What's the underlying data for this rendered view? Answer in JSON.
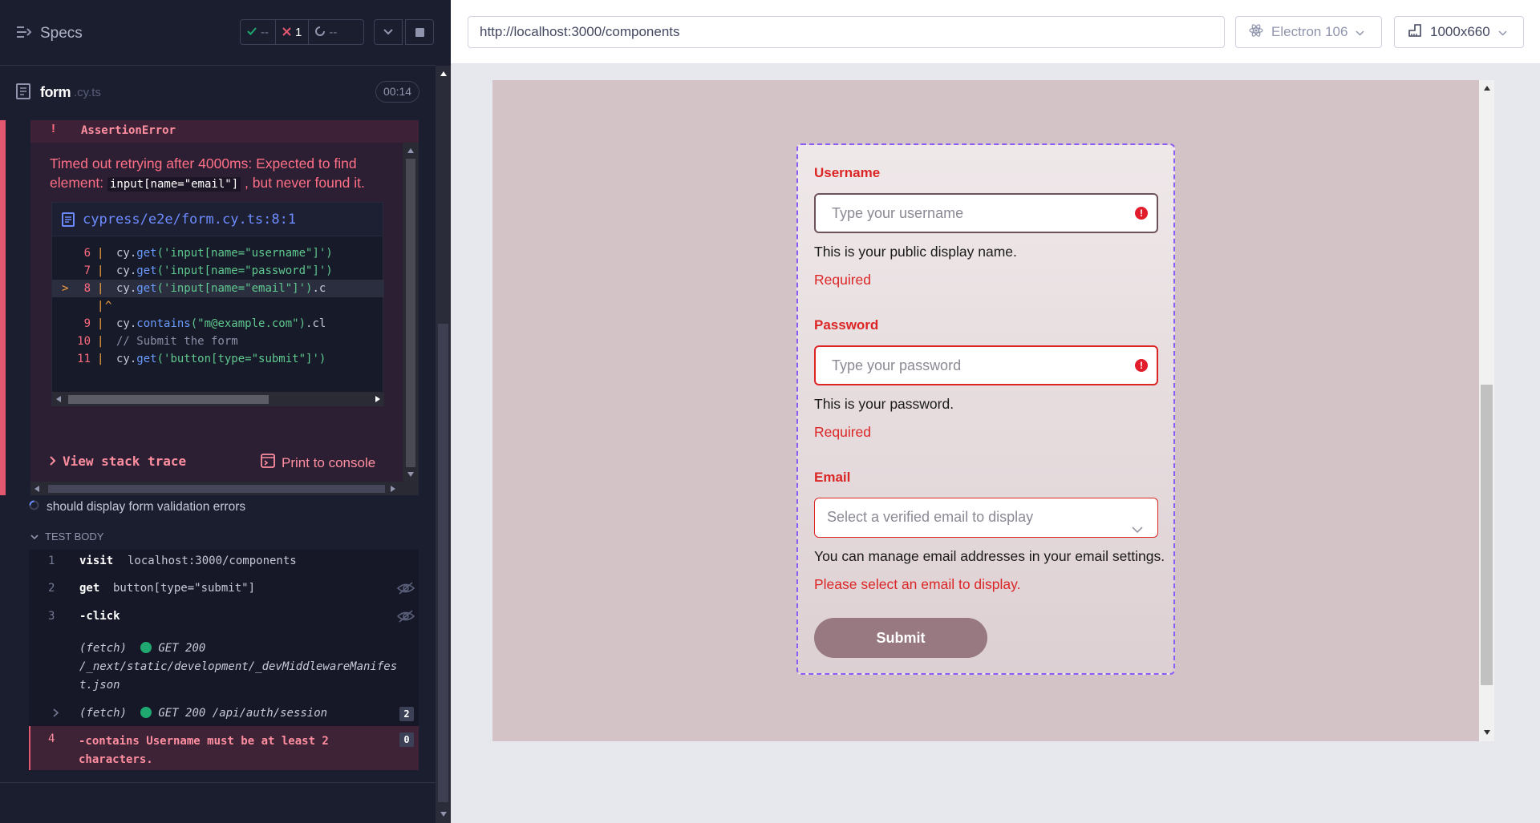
{
  "runner": {
    "specs_label": "Specs",
    "stats": {
      "passed": "--",
      "failed": "1",
      "pending": "--"
    },
    "file": {
      "name": "form",
      "ext": ".cy.ts",
      "duration": "00:14"
    }
  },
  "error": {
    "bang": "!",
    "type": "AssertionError",
    "message_before": "Timed out retrying after 4000ms: Expected to find element: ",
    "message_code": "input[name=\"email\"]",
    "message_after": " , but never found it.",
    "code_path": "cypress/e2e/form.cy.ts:8:1",
    "code_lines": [
      {
        "n": "6",
        "pre": "cy.",
        "kw": "get",
        "s": "('input[name=\"username\"]')",
        "post": ""
      },
      {
        "n": "7",
        "pre": "cy.",
        "kw": "get",
        "s": "('input[name=\"password\"]')",
        "post": ""
      },
      {
        "n": "8",
        "pre": "cy.",
        "kw": "get",
        "s": "('input[name=\"email\"]')",
        "post": ".c"
      },
      {
        "n": "",
        "caret": "^"
      },
      {
        "n": "9",
        "pre": "cy.",
        "kw": "contains",
        "s": "(\"m@example.com\")",
        "post": ".cl"
      },
      {
        "n": "10",
        "comment": "// Submit the form"
      },
      {
        "n": "11",
        "pre": "cy.",
        "kw": "get",
        "s": "('button[type=\"submit\"]')",
        "post": ""
      }
    ],
    "stack_label": "View stack trace",
    "print_label": "Print to console"
  },
  "test": {
    "title": "should display form validation errors",
    "body_label": "TEST BODY",
    "commands": [
      {
        "n": "1",
        "name": "visit",
        "arg": "localhost:3000/components"
      },
      {
        "n": "2",
        "name": "get",
        "arg": "button[type=\"submit\"]"
      },
      {
        "n": "3",
        "name": "-click",
        "arg": ""
      }
    ],
    "fetch1": {
      "label": "(fetch)",
      "status": "GET 200",
      "url": "/_next/static/development/_devMiddlewareManifest.json",
      "url_l1": "/_next/static/development/_devMiddlewareManifes",
      "url_l2": "t.json"
    },
    "fetch2": {
      "label": "(fetch)",
      "status": "GET 200",
      "url": "/api/auth/session",
      "count": "2"
    },
    "cmd4": {
      "n": "4",
      "name": "-contains",
      "arg": "Username must be at least 2 characters.",
      "line1": "-contains  Username must be at least 2",
      "line2": "characters.",
      "count": "0"
    }
  },
  "browser": {
    "url": "http://localhost:3000/components",
    "engine": "Electron 106",
    "viewport": "1000x660"
  },
  "form": {
    "username": {
      "label": "Username",
      "placeholder": "Type your username",
      "help": "This is your public display name.",
      "error": "Required"
    },
    "password": {
      "label": "Password",
      "placeholder": "Type your password",
      "help": "This is your password.",
      "error": "Required"
    },
    "email": {
      "label": "Email",
      "placeholder": "Select a verified email to display",
      "help": "You can manage email addresses in your email settings.",
      "error": "Please select an email to display."
    },
    "submit": "Submit"
  },
  "colors": {
    "error": "#dc2626",
    "accent_dash": "#8b5cf6",
    "submit_bg": "#987881",
    "runner_bg": "#1b1e2e"
  }
}
